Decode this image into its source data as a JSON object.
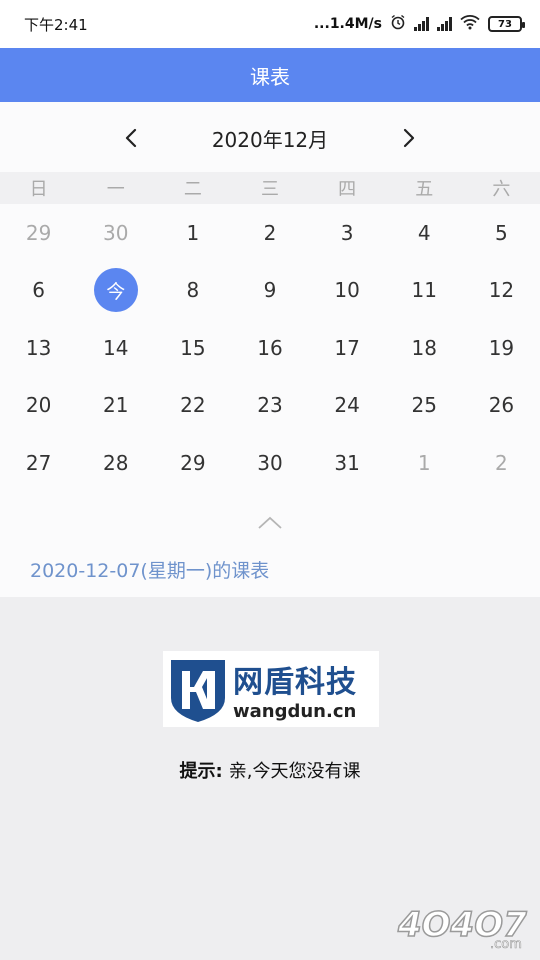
{
  "status_bar": {
    "time": "下午2:41",
    "network_speed": "...1.4M/s",
    "battery": "73",
    "icons": [
      "alarm-icon",
      "signal-hd-icon",
      "signal-hd-icon",
      "wifi-icon",
      "battery-icon"
    ]
  },
  "header": {
    "title": "课表"
  },
  "calendar": {
    "month_label": "2020年12月",
    "weekdays": [
      "日",
      "一",
      "二",
      "三",
      "四",
      "五",
      "六"
    ],
    "days": [
      {
        "label": "29",
        "muted": true
      },
      {
        "label": "30",
        "muted": true
      },
      {
        "label": "1"
      },
      {
        "label": "2"
      },
      {
        "label": "3"
      },
      {
        "label": "4"
      },
      {
        "label": "5"
      },
      {
        "label": "6"
      },
      {
        "label": "今",
        "today": true
      },
      {
        "label": "8"
      },
      {
        "label": "9"
      },
      {
        "label": "10"
      },
      {
        "label": "11"
      },
      {
        "label": "12"
      },
      {
        "label": "13"
      },
      {
        "label": "14"
      },
      {
        "label": "15"
      },
      {
        "label": "16"
      },
      {
        "label": "17"
      },
      {
        "label": "18"
      },
      {
        "label": "19"
      },
      {
        "label": "20"
      },
      {
        "label": "21"
      },
      {
        "label": "22"
      },
      {
        "label": "23"
      },
      {
        "label": "24"
      },
      {
        "label": "25"
      },
      {
        "label": "26"
      },
      {
        "label": "27"
      },
      {
        "label": "28"
      },
      {
        "label": "29"
      },
      {
        "label": "30"
      },
      {
        "label": "31"
      },
      {
        "label": "1",
        "muted": true
      },
      {
        "label": "2",
        "muted": true
      }
    ]
  },
  "schedule": {
    "date_title": "2020-12-07(星期一)的课表"
  },
  "empty_state": {
    "logo_cn": "网盾科技",
    "logo_en": "wangdun.cn",
    "hint_label": "提示:",
    "hint_text": "亲,今天您没有课"
  },
  "watermark": {
    "text": "4O4O7",
    "suffix": ".com"
  },
  "colors": {
    "accent": "#5b86f0",
    "schedule_link": "#6f93cc",
    "muted_text": "#aaaaaa",
    "logo_blue": "#1f4f8f"
  }
}
